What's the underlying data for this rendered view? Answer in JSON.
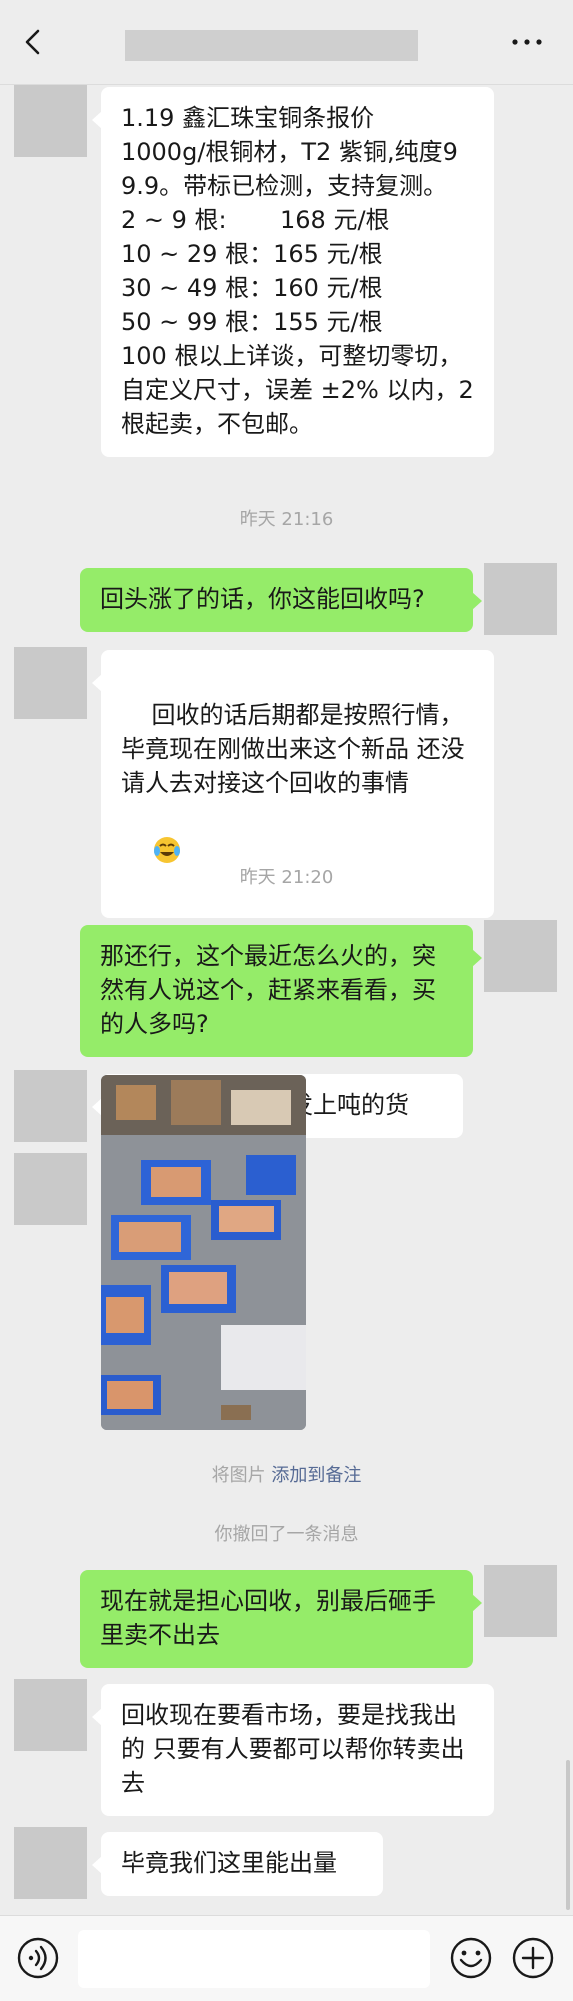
{
  "header": {
    "title": ""
  },
  "messages": {
    "m1": "1.19 鑫汇珠宝铜条报价\n1000g/根铜材，T2 紫铜,纯度99.9。带标已检测，支持复测。\n2 ~ 9 根:       168 元/根\n10 ~ 29 根：165 元/根\n30 ~ 49 根：160 元/根\n50 ~ 99 根：155 元/根\n100 根以上详谈，可整切零切，自定义尺寸，误差 ±2% 以内，2 根起卖，不包邮。",
    "ts1": "昨天 21:16",
    "m2": "回头涨了的话，你这能回收吗?",
    "m3": "回收的话后期都是按照行情，毕竟现在刚做出来这个新品 还没请人去对接这个回收的事情",
    "ts2": "昨天 21:20",
    "m4": "那还行，这个最近怎么火的，突然有人说这个，赶紧来看看，买的人多吗?",
    "m5": "肯定了，每天都发上吨的货",
    "img_note_prefix": "将图片 ",
    "img_note_link": "添加到备注",
    "recall": "你撤回了一条消息",
    "m6": "现在就是担心回收，别最后砸手里卖不出去",
    "m7": "回收现在要看市场，要是找我出的 只要有人要都可以帮你转卖出去",
    "m8": "毕竟我们这里能出量"
  },
  "input": {
    "value": ""
  },
  "icons": {
    "back": "chevron-left-icon",
    "more": "more-dots-icon",
    "voice": "voice-icon",
    "emoji": "emoji-icon",
    "plus": "plus-icon",
    "inline_emoji": "laughing-crying-emoji"
  },
  "colors": {
    "background": "#ededed",
    "bubble_sent": "#95ec69",
    "bubble_received": "#ffffff",
    "link": "#576b95",
    "timestamp": "#a6a6a6"
  }
}
